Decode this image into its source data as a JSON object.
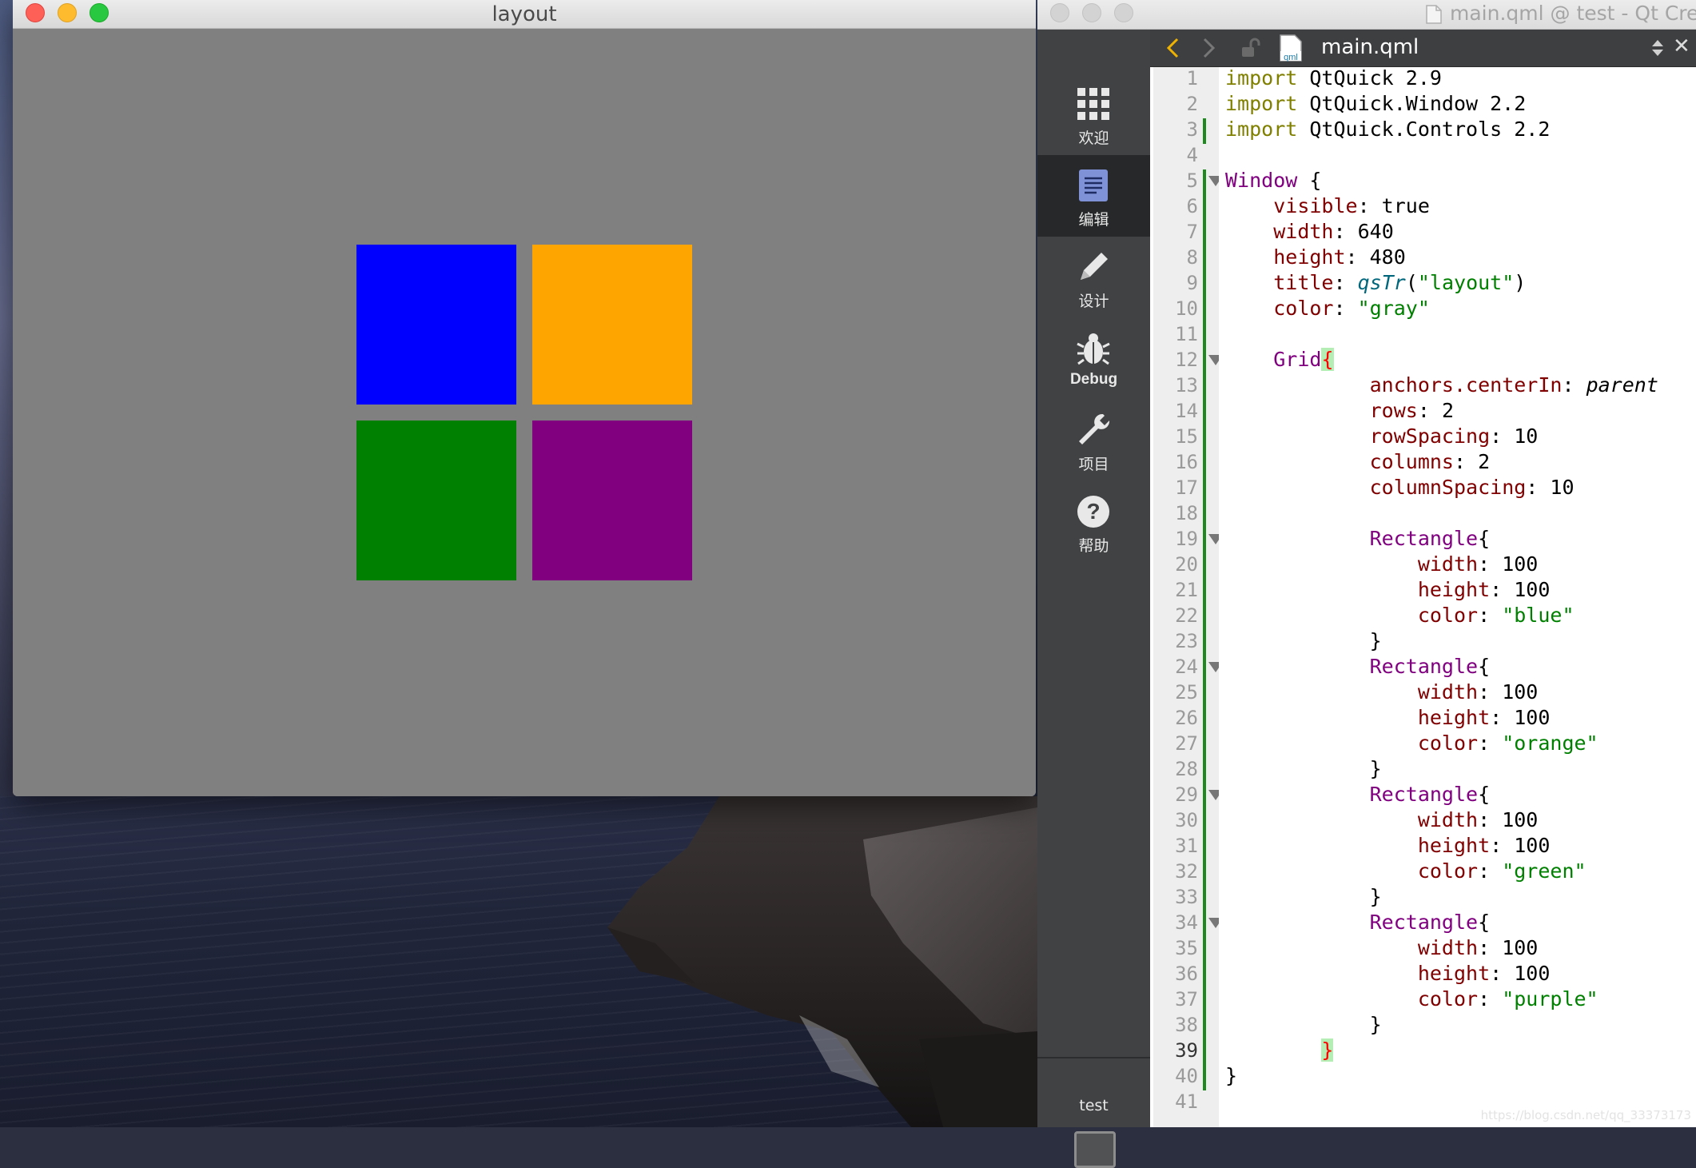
{
  "layout_window": {
    "title": "layout",
    "background": "#808080",
    "grid_colors": [
      "#0000ff",
      "#ffa500",
      "#008000",
      "#800080"
    ]
  },
  "qt_creator": {
    "title": "main.qml @ test - Qt Cre",
    "file_name": "main.qml",
    "file_icon_text": "qml",
    "modes": [
      {
        "label": "欢迎",
        "icon": "welcome-grid-icon"
      },
      {
        "label": "编辑",
        "icon": "edit-document-icon"
      },
      {
        "label": "设计",
        "icon": "design-pencil-icon"
      },
      {
        "label": "Debug",
        "icon": "debug-bug-icon"
      },
      {
        "label": "项目",
        "icon": "projects-wrench-icon"
      },
      {
        "label": "帮助",
        "icon": "help-question-icon"
      }
    ],
    "target_label": "test",
    "current_line": 39,
    "code_lines": [
      "import QtQuick 2.9",
      "import QtQuick.Window 2.2",
      "import QtQuick.Controls 2.2",
      "",
      "Window {",
      "    visible: true",
      "    width: 640",
      "    height: 480",
      "    title: qsTr(\"layout\")",
      "    color: \"gray\"",
      "",
      "    Grid{",
      "            anchors.centerIn: parent",
      "            rows: 2",
      "            rowSpacing: 10",
      "            columns: 2",
      "            columnSpacing: 10",
      "",
      "            Rectangle{",
      "                width: 100",
      "                height: 100",
      "                color: \"blue\"",
      "            }",
      "            Rectangle{",
      "                width: 100",
      "                height: 100",
      "                color: \"orange\"",
      "            }",
      "            Rectangle{",
      "                width: 100",
      "                height: 100",
      "                color: \"green\"",
      "            }",
      "            Rectangle{",
      "                width: 100",
      "                height: 100",
      "                color: \"purple\"",
      "            }",
      "        }",
      "}",
      ""
    ],
    "fold_lines": [
      5,
      12,
      19,
      24,
      29,
      34
    ],
    "watermark": "https://blog.csdn.net/qq_33373173"
  }
}
